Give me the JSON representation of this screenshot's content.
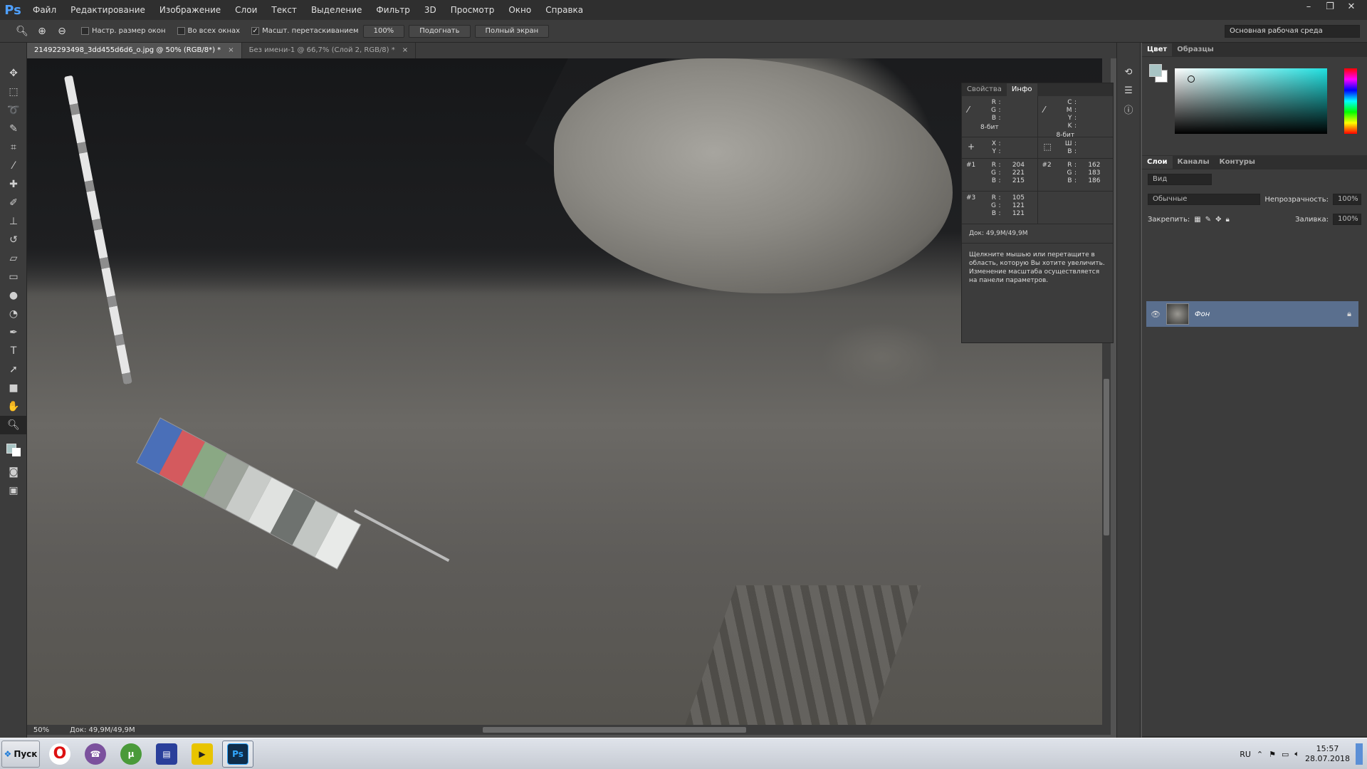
{
  "app": {
    "logo": "Ps"
  },
  "menu": [
    "Файл",
    "Редактирование",
    "Изображение",
    "Слои",
    "Текст",
    "Выделение",
    "Фильтр",
    "3D",
    "Просмотр",
    "Окно",
    "Справка"
  ],
  "window_controls": {
    "minimize": "–",
    "restore": "❐",
    "close": "✕"
  },
  "options": {
    "resize_windows": "Настр. размер окон",
    "all_windows": "Во всех окнах",
    "scrubby_zoom": "Масшт. перетаскиванием",
    "zoom_100": "100%",
    "fit": "Подогнать",
    "fullscreen": "Полный экран",
    "workspace": "Основная рабочая среда"
  },
  "tabs": [
    {
      "label": "21492293498_3dd455d6d6_o.jpg @ 50% (RGB/8*) *",
      "close": "×",
      "active": true
    },
    {
      "label": "Без имени-1 @ 66,7% (Слой 2, RGB/8) *",
      "close": "×",
      "active": false
    }
  ],
  "status": {
    "zoom": "50%",
    "doc": "Док: 49,9M/49,9M"
  },
  "info_panel": {
    "tabs": [
      "Свойства",
      "Инфо"
    ],
    "rgb": {
      "labels": [
        "R",
        "G",
        "B"
      ],
      "bits": "8-бит"
    },
    "cmyk": {
      "labels": [
        "C",
        "M",
        "Y",
        "K"
      ],
      "bits": "8-бит"
    },
    "xy": {
      "labels": [
        "X",
        "Y"
      ]
    },
    "wh": {
      "labels": [
        "Ш",
        "В"
      ]
    },
    "samplers": [
      {
        "id": "#1",
        "R": "204",
        "G": "221",
        "B": "215"
      },
      {
        "id": "#2",
        "R": "162",
        "G": "183",
        "B": "186"
      },
      {
        "id": "#3",
        "R": "105",
        "G": "121",
        "B": "121"
      }
    ],
    "doc": "Док: 49,9M/49,9M",
    "hint": "Щелкните мышью или перетащите в область, которую Вы хотите увеличить. Изменение масштаба осуществляется на панели параметров."
  },
  "color_panel": {
    "tabs": [
      "Цвет",
      "Образцы"
    ],
    "fg": "#a8c4c4",
    "bg": "#ffffff"
  },
  "layers_panel": {
    "tabs": [
      "Слои",
      "Каналы",
      "Контуры"
    ],
    "kind": "Вид",
    "blend": "Обычные",
    "opacity_label": "Непрозрачность:",
    "opacity": "100%",
    "lock_label": "Закрепить:",
    "fill_label": "Заливка:",
    "fill": "100%",
    "layer_name": "Фон"
  },
  "taskbar": {
    "start": "Пуск",
    "apps": [
      "Opera",
      "Viber",
      "uTorrent",
      "Save",
      "Player",
      "Ps"
    ],
    "lang": "RU",
    "time": "15:57",
    "date": "28.07.2018"
  },
  "colors": {
    "gnomon": [
      "#4a6fb8",
      "#d45a5e",
      "#8aa884",
      "#9da39b",
      "#c8cbc8",
      "#e0e2e0",
      "#6e726f",
      "#c2c6c3",
      "#e8eae8"
    ]
  }
}
